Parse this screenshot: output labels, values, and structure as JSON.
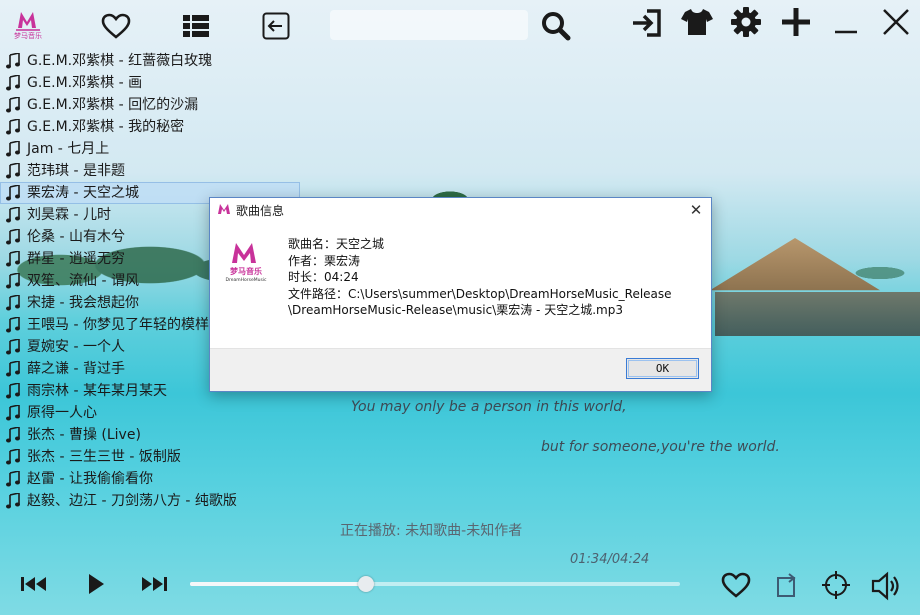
{
  "app": {
    "logo_text": "梦马音乐",
    "logo_subtext": "DreamHorseMusic",
    "search_placeholder": ""
  },
  "toolbar": {
    "icons": [
      "heart-icon",
      "list-icon",
      "back-arrow-icon",
      "search-icon",
      "sign-in-icon",
      "shirt-icon",
      "gear-icon",
      "plus-icon",
      "minimize-icon",
      "close-icon"
    ]
  },
  "playlist": {
    "items": [
      {
        "label": "G.E.M.邓紫棋 - 红蔷薇白玫瑰"
      },
      {
        "label": "G.E.M.邓紫棋 - 画"
      },
      {
        "label": "G.E.M.邓紫棋 - 回忆的沙漏"
      },
      {
        "label": "G.E.M.邓紫棋 - 我的秘密"
      },
      {
        "label": "Jam - 七月上"
      },
      {
        "label": "范玮琪 - 是非题"
      },
      {
        "label": "栗宏涛 - 天空之城"
      },
      {
        "label": "刘昊霖 - 儿时"
      },
      {
        "label": "伦桑 - 山有木兮"
      },
      {
        "label": "群星 - 逍遥无穷"
      },
      {
        "label": "双笙、流仙 - 谓风"
      },
      {
        "label": "宋捷 - 我会想起你"
      },
      {
        "label": "王喂马 - 你梦见了年轻的模样"
      },
      {
        "label": "夏婉安 - 一个人"
      },
      {
        "label": "薛之谦 - 背过手"
      },
      {
        "label": "雨宗林 - 某年某月某天"
      },
      {
        "label": "原得一人心"
      },
      {
        "label": "张杰 - 曹操 (Live)"
      },
      {
        "label": "张杰 - 三生三世 - 饭制版"
      },
      {
        "label": "赵雷 - 让我偷偷看你"
      },
      {
        "label": "赵毅、边江 - 刀剑荡八方 - 纯歌版"
      }
    ],
    "selected_index": 6
  },
  "lyrics": {
    "line1": "You may only be a person in this world,",
    "line2": "but for someone,you're the world."
  },
  "player": {
    "now_playing": "正在播放: 未知歌曲-未知作者",
    "time": "01:34/04:24",
    "progress": 0.36
  },
  "dialog": {
    "title": "歌曲信息",
    "song_name": "歌曲名：天空之城",
    "author": "作者：栗宏涛",
    "duration": "时长：04:24",
    "path_line1": " 文件路径：C:\\Users\\summer\\Desktop\\DreamHorseMusic_Release",
    "path_line2": "\\DreamHorseMusic-Release\\music\\栗宏涛 - 天空之城.mp3",
    "ok_label": "OK",
    "close_glyph": "✕"
  },
  "colors": {
    "accent_logo": "#c8329a",
    "selected_row": "#bedcf5",
    "dialog_border": "#5b86c5"
  }
}
